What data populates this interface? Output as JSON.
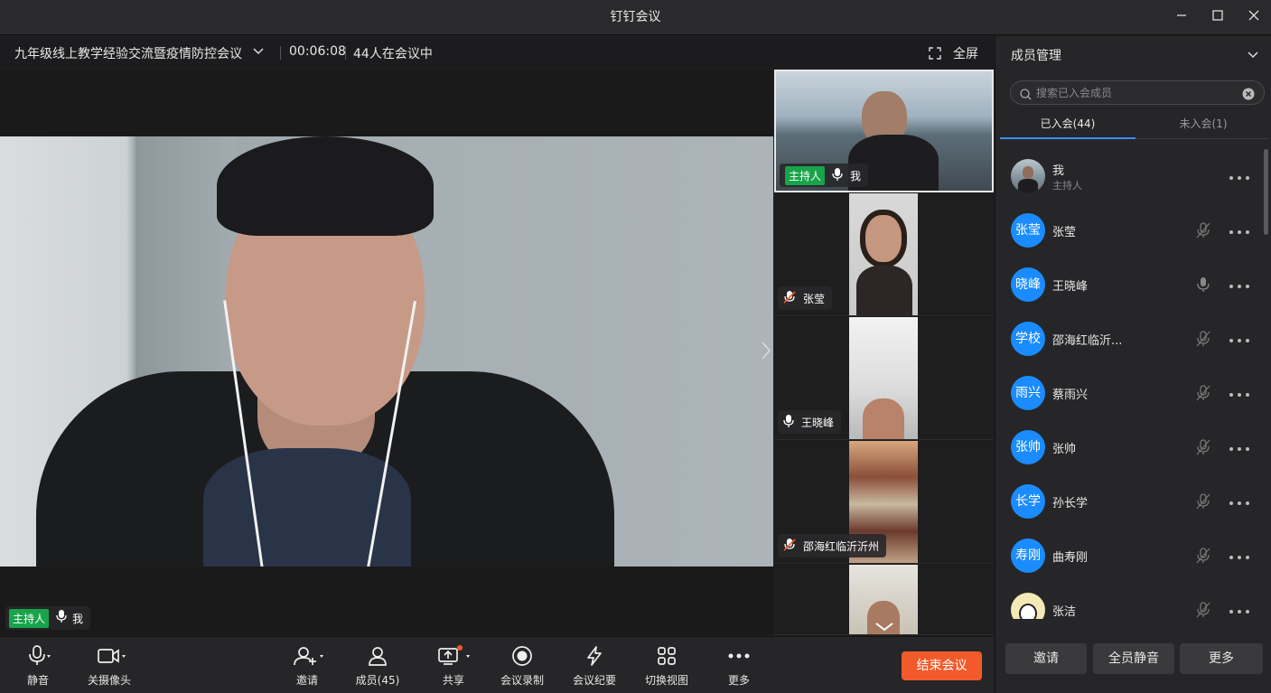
{
  "window": {
    "title": "钉钉会议",
    "minimize_icon": "minimize-icon",
    "maximize_icon": "maximize-icon",
    "close_icon": "close-icon"
  },
  "meeting": {
    "name": "九年级线上教学经验交流暨疫情防控会议",
    "timer": "00:06:08",
    "attendee_count": "44人在会议中",
    "fullscreen_label": "全屏"
  },
  "main_video": {
    "host_tag": "主持人",
    "name": "我"
  },
  "thumbnails": [
    {
      "host_tag": "主持人",
      "name": "我",
      "mic": "on"
    },
    {
      "name": "张莹",
      "mic": "muted"
    },
    {
      "name": "王晓峰",
      "mic": "on"
    },
    {
      "name": "邵海红临沂沂州",
      "mic": "muted"
    },
    {
      "name": "",
      "mic": ""
    }
  ],
  "panel": {
    "title": "成员管理",
    "search_placeholder": "搜索已入会成员",
    "tabs": [
      {
        "label": "已入会(44)"
      },
      {
        "label": "未入会(1)"
      }
    ],
    "members": [
      {
        "avatar": "",
        "name": "我",
        "role": "主持人",
        "mic": "none"
      },
      {
        "avatar": "张莹",
        "name": "张莹",
        "mic": "muted"
      },
      {
        "avatar": "晓峰",
        "name": "王晓峰",
        "mic": "on"
      },
      {
        "avatar": "学校",
        "name": "邵海红临沂...",
        "mic": "muted"
      },
      {
        "avatar": "雨兴",
        "name": "蔡雨兴",
        "mic": "muted"
      },
      {
        "avatar": "张帅",
        "name": "张帅",
        "mic": "muted"
      },
      {
        "avatar": "长学",
        "name": "孙长学",
        "mic": "muted"
      },
      {
        "avatar": "寿刚",
        "name": "曲寿刚",
        "mic": "muted"
      },
      {
        "avatar": "",
        "name": "张洁",
        "mic": "muted"
      }
    ],
    "buttons": {
      "invite": "邀请",
      "mute_all": "全员静音",
      "more": "更多"
    }
  },
  "toolbar": {
    "mute": "静音",
    "camera_off": "关摄像头",
    "invite": "邀请",
    "members": "成员(45)",
    "share": "共享",
    "record": "会议录制",
    "minutes": "会议纪要",
    "switch_view": "切换视图",
    "more": "更多",
    "end_meeting": "结束会议"
  },
  "colors": {
    "accent": "#1a8cff",
    "host_green": "#19a34a",
    "end_red": "#f25a2b",
    "notify_dot": "#f25a2b"
  }
}
